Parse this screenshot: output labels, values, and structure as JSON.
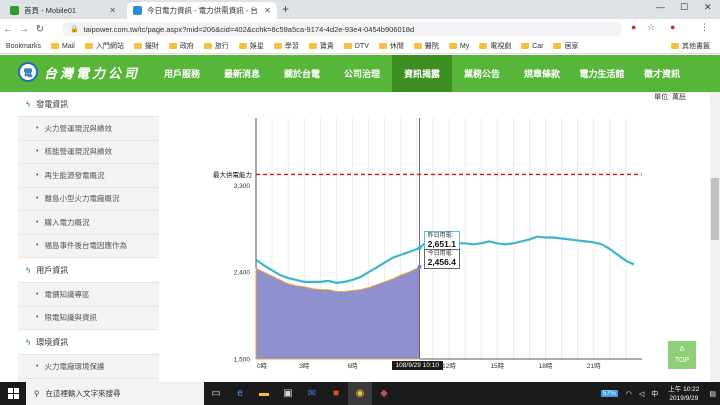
{
  "browser": {
    "tabs": [
      {
        "title": "首頁 - Mobile01",
        "active": false
      },
      {
        "title": "今日電力資訊 - 電力供需資訊 - 台",
        "active": true
      }
    ],
    "url": "taipower.com.tw/tc/page.aspx?mid=206&cid=402&cchk=8c59a5ca-9174-4d2e-93e4-0454b906018d",
    "bookmarks": [
      "Bookmarks",
      "Mail",
      "入門網站",
      "撮財",
      "政府",
      "旅行",
      "娛星",
      "學習",
      "寶貴",
      "DTV",
      "休閒",
      "醫院",
      "My",
      "電視劇",
      "Car",
      "居家"
    ],
    "other_bookmarks": "其他書籤"
  },
  "site": {
    "logo_text": "台灣電力公司",
    "nav": [
      "用戶服務",
      "最新消息",
      "關於台電",
      "公司治理",
      "資訊揭露",
      "業務公告",
      "規章條款",
      "電力生活館",
      "徵才資訊"
    ],
    "active_nav": "資訊揭露"
  },
  "sidebar": {
    "groups": [
      {
        "title": "發電資訊",
        "items": [
          "火力營運現況與績效",
          "核能營運現況與績效",
          "再生能源發電概況",
          "離島小型火力電廠概況",
          "購入電力概況",
          "福島事件後台電因應作為"
        ]
      },
      {
        "title": "用戶資訊",
        "items": [
          "電價知識專區",
          "限電知識與資訊"
        ]
      },
      {
        "title": "環境資訊",
        "items": [
          "火力電廠環境保護"
        ]
      }
    ]
  },
  "chart_data": {
    "type": "line",
    "unit_label": "單位: 萬瓩",
    "ylim": [
      1500,
      4000
    ],
    "yticks": [
      1500,
      2400,
      3300
    ],
    "ytick_labels": [
      "1,500",
      "2,400",
      "3,300"
    ],
    "xticks": [
      "0時",
      "3時",
      "6時",
      "12時",
      "15時",
      "18時",
      "21時"
    ],
    "max_capacity": {
      "label": "最大供電能力",
      "value": 3415
    },
    "time_marker": "108/9/29 10:10",
    "tooltips": {
      "yesterday": {
        "label": "昨日用電:",
        "value": "2,651.1"
      },
      "today": {
        "label": "今日用電:",
        "value": "2,456.4"
      }
    },
    "series": [
      {
        "name": "昨日用電",
        "color": "#3fb4d0",
        "x": [
          0,
          0.5,
          1,
          1.5,
          2,
          2.5,
          3,
          3.5,
          4,
          4.5,
          5,
          5.5,
          6,
          6.5,
          7,
          7.5,
          8,
          8.5,
          9,
          9.5,
          10,
          10.17,
          10.5,
          11,
          11.5,
          12,
          12.5,
          13,
          13.5,
          14,
          14.5,
          15,
          15.5,
          16,
          16.5,
          17,
          17.5,
          18,
          18.5,
          19,
          19.5,
          20,
          20.5,
          21,
          21.5,
          22,
          22.5,
          23,
          23.5
        ],
        "values": [
          2530,
          2470,
          2420,
          2370,
          2340,
          2320,
          2300,
          2300,
          2300,
          2310,
          2290,
          2300,
          2320,
          2350,
          2400,
          2450,
          2500,
          2550,
          2580,
          2610,
          2640,
          2651,
          2700,
          2740,
          2730,
          2710,
          2700,
          2700,
          2690,
          2700,
          2720,
          2700,
          2690,
          2700,
          2720,
          2740,
          2770,
          2760,
          2760,
          2750,
          2740,
          2730,
          2720,
          2710,
          2690,
          2640,
          2580,
          2520,
          2480
        ]
      },
      {
        "name": "今日用電",
        "color": "#7b7cc4",
        "x": [
          0,
          0.5,
          1,
          1.5,
          2,
          2.5,
          3,
          3.5,
          4,
          4.5,
          5,
          5.5,
          6,
          6.5,
          7,
          7.5,
          8,
          8.5,
          9,
          9.5,
          10,
          10.17
        ],
        "values": [
          2440,
          2400,
          2360,
          2320,
          2280,
          2260,
          2250,
          2230,
          2220,
          2220,
          2200,
          2200,
          2210,
          2220,
          2240,
          2270,
          2300,
          2330,
          2370,
          2400,
          2440,
          2456
        ]
      }
    ]
  },
  "totop": {
    "arrow": "Δ",
    "label": "TOP"
  },
  "taskbar": {
    "search_placeholder": "在這裡輸入文字來搜尋",
    "battery": "57%",
    "time": "上午 10:22",
    "date": "2019/9/29"
  }
}
